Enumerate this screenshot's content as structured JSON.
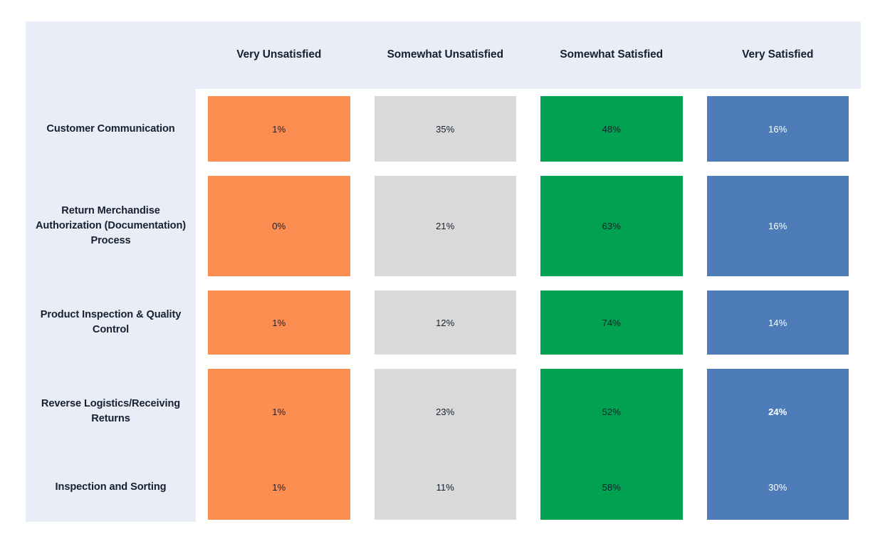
{
  "colors": {
    "panel_tint": "#e9edf7",
    "background": "#ffffff",
    "text_dark": "#16202e",
    "text_light": "#ffffff",
    "very_unsatisfied": "#fc8e51",
    "somewhat_unsatisfied": "#d9d9d9",
    "somewhat_satisfied": "#00a150",
    "very_satisfied": "#4d7cb8"
  },
  "chart_data": {
    "type": "heatmap",
    "title": "",
    "subtitle": "",
    "xlabel": "",
    "ylabel": "",
    "grid": false,
    "legend_position": "none",
    "orientation": "rows-are-categories",
    "categories": [
      "Customer Communication",
      "Return Merchandise Authorization (Documentation) Process",
      "Product Inspection & Quality Control",
      "Reverse Logistics/Receiving Returns",
      "Inspection and Sorting"
    ],
    "columns": [
      "Very Unsatisfied",
      "Somewhat Unsatisfied",
      "Somewhat Satisfied",
      "Very Satisfied"
    ],
    "column_colors": [
      "#fc8e51",
      "#d9d9d9",
      "#00a150",
      "#4d7cb8"
    ],
    "column_label_colors": [
      "dark",
      "dark",
      "dark",
      "light"
    ],
    "series": [
      {
        "name": "Very Unsatisfied",
        "values": [
          1,
          0,
          1,
          1,
          1
        ]
      },
      {
        "name": "Somewhat Unsatisfied",
        "values": [
          35,
          21,
          12,
          23,
          11
        ]
      },
      {
        "name": "Somewhat Satisfied",
        "values": [
          48,
          63,
          74,
          52,
          58
        ]
      },
      {
        "name": "Very Satisfied",
        "values": [
          16,
          16,
          14,
          24,
          30
        ]
      }
    ],
    "cell_labels": [
      [
        "1%",
        "35%",
        "48%",
        "16%"
      ],
      [
        "0%",
        "21%",
        "63%",
        "16%"
      ],
      [
        "1%",
        "12%",
        "74%",
        "14%"
      ],
      [
        "1%",
        "23%",
        "52%",
        "24%"
      ],
      [
        "1%",
        "11%",
        "58%",
        "30%"
      ]
    ],
    "emphasized_cells": [
      [
        3,
        3
      ]
    ],
    "value_unit": "%",
    "value_range": [
      0,
      100
    ]
  },
  "header": {
    "columns": [
      {
        "label": "Very Unsatisfied"
      },
      {
        "label": "Somewhat Unsatisfied"
      },
      {
        "label": "Somewhat Satisfied"
      },
      {
        "label": "Very Satisfied"
      }
    ]
  },
  "rows": [
    {
      "label": "Customer Communication"
    },
    {
      "label": "Return Merchandise Authorization (Documentation) Process"
    },
    {
      "label": "Product Inspection & Quality Control"
    },
    {
      "label": "Reverse Logistics/Receiving Returns"
    },
    {
      "label": "Inspection and Sorting"
    }
  ]
}
